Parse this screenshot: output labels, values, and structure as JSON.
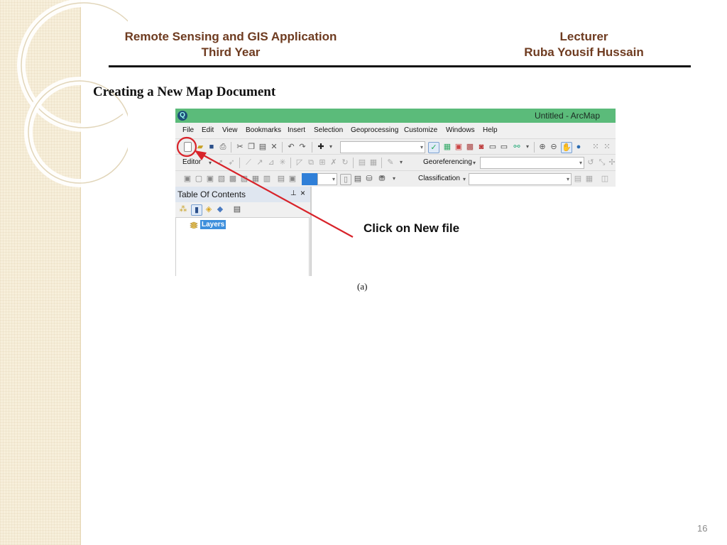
{
  "header": {
    "course_line1": "Remote Sensing and GIS Application",
    "course_line2": "Third Year",
    "lecturer_label": "Lecturer",
    "lecturer_name": "Ruba Yousif Hussain"
  },
  "slide": {
    "title": "Creating a New Map Document",
    "callout": "Click on New file",
    "caption": "(a)",
    "page_number": "16",
    "annotation_color": "#d8232a",
    "accent_text_color": "#6e3b20"
  },
  "arcmap": {
    "window_title": "Untitled - ArcMap",
    "titlebar_color": "#5bbb7a",
    "menu": [
      "File",
      "Edit",
      "View",
      "Bookmarks",
      "Insert",
      "Selection",
      "Geoprocessing",
      "Customize",
      "Windows",
      "Help"
    ],
    "toolbar2": {
      "editor_label": "Editor",
      "georeferencing_label": "Georeferencing"
    },
    "toolbar3": {
      "classification_label": "Classification"
    },
    "toc": {
      "title": "Table Of Contents",
      "pin_icon": "pin-icon",
      "close_icon": "close-icon",
      "layer_name": "Layers"
    }
  }
}
